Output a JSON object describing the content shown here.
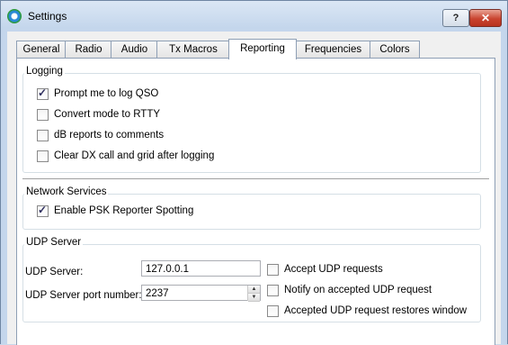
{
  "window": {
    "title": "Settings",
    "help_label": "?",
    "close_label": "✕"
  },
  "tabs": [
    {
      "label": "General"
    },
    {
      "label": "Radio"
    },
    {
      "label": "Audio"
    },
    {
      "label": "Tx Macros"
    },
    {
      "label": "Reporting",
      "active": true
    },
    {
      "label": "Frequencies"
    },
    {
      "label": "Colors"
    }
  ],
  "logging": {
    "title": "Logging",
    "items": [
      {
        "label": "Prompt me to log QSO",
        "checked": true
      },
      {
        "label": "Convert mode to RTTY",
        "checked": false
      },
      {
        "label": "dB reports to comments",
        "checked": false
      },
      {
        "label": "Clear DX call and grid after logging",
        "checked": false
      }
    ]
  },
  "network": {
    "title": "Network Services",
    "items": [
      {
        "label": "Enable PSK Reporter Spotting",
        "checked": true
      }
    ]
  },
  "udp": {
    "title": "UDP Server",
    "server_label": "UDP Server:",
    "server_value": "127.0.0.1",
    "port_label": "UDP Server port number:",
    "port_value": "2237",
    "options": [
      {
        "label": "Accept UDP requests",
        "checked": false
      },
      {
        "label": "Notify on accepted UDP request",
        "checked": false
      },
      {
        "label": "Accepted UDP request restores window",
        "checked": false
      }
    ]
  },
  "check_glyph": "✓"
}
